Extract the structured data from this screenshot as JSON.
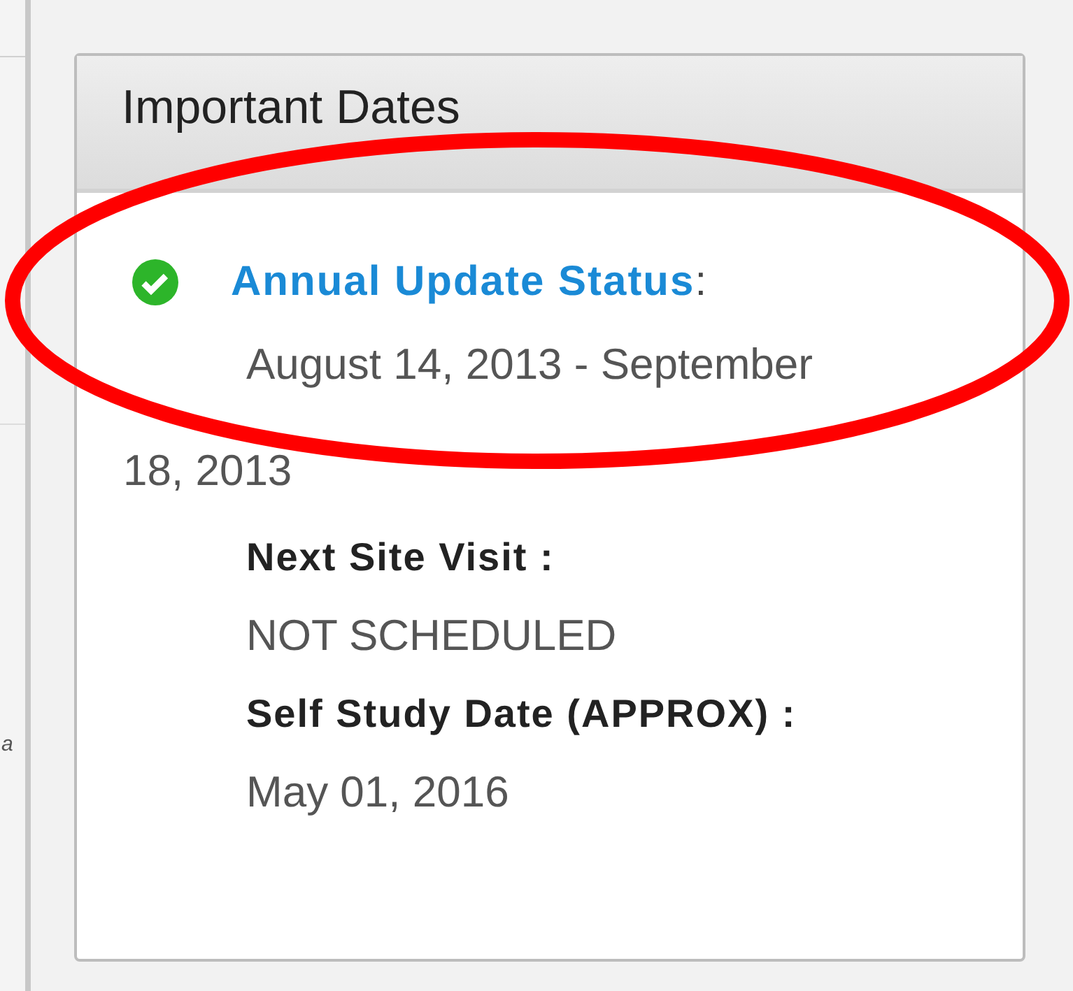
{
  "sidebar": {
    "cut_text": "a"
  },
  "panel": {
    "title": "Important Dates",
    "items": [
      {
        "kind": "link",
        "label": "Annual Update Status",
        "suffix": ":",
        "value": "August 14, 2013 - September 18, 2013"
      },
      {
        "kind": "field",
        "label": "Next Site Visit :",
        "value": "NOT SCHEDULED"
      },
      {
        "kind": "field",
        "label": "Self Study Date (APPROX) :",
        "value": "May 01, 2016"
      }
    ]
  }
}
